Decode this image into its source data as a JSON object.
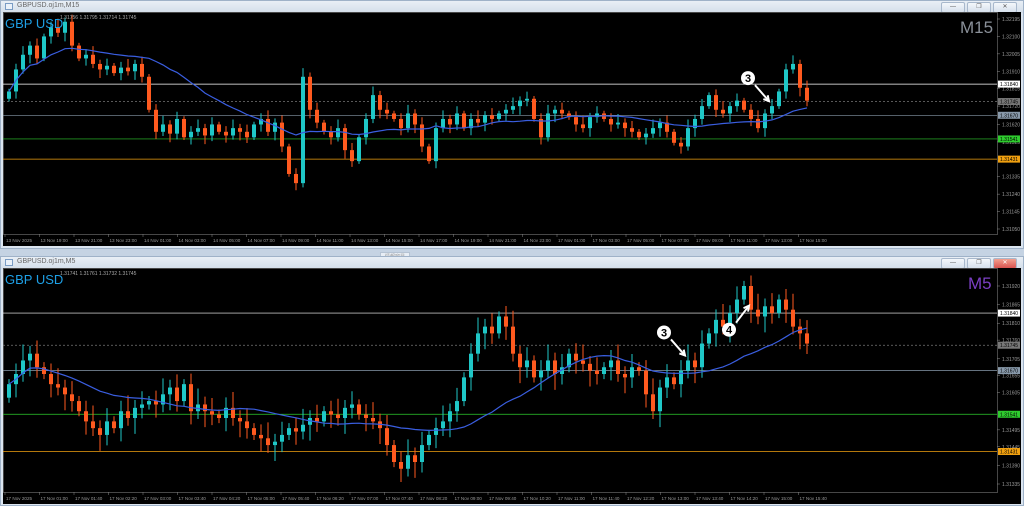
{
  "windows": [
    {
      "title": "GBPUSD.oj1m,M15",
      "ohlc": "1.31756 1.31795 1.31714 1.31745",
      "symbol_label": "GBP USD",
      "timeframe_label": "M15",
      "timeframe_color": "#8a9099",
      "buttons": [
        "minimize",
        "restore",
        "close"
      ]
    },
    {
      "title": "GBPUSD.oj1m,M5",
      "ohlc": "1.31741 1.31761 1.31732 1.31745",
      "symbol_label": "GBP USD",
      "timeframe_label": "M5",
      "timeframe_color": "#7b3fc4",
      "buttons": [
        "minimize",
        "restore",
        "close"
      ]
    }
  ],
  "mid_tab_label": "情報窗显",
  "colors": {
    "bull": "#1fc7c7",
    "bear": "#ff5a1f",
    "ma": "#3a5ee0",
    "grid_text": "#9a9a9a"
  },
  "chart_data": [
    {
      "type": "candlestick",
      "title": "GBPUSD M15",
      "ylim": [
        1.3105,
        1.32195
      ],
      "yticks": [
        "1.32195",
        "1.32100",
        "1.32005",
        "1.31910",
        "1.31815",
        "1.31720",
        "1.31620",
        "1.31525",
        "1.31335",
        "1.31240",
        "1.31145",
        "1.31050"
      ],
      "levels": [
        {
          "value": 1.3184,
          "label": "1.31840",
          "color": "#ffffff"
        },
        {
          "value": 1.31745,
          "label": "1.31745",
          "color": "#777777"
        },
        {
          "value": 1.3167,
          "label": "1.31670",
          "color": "#8899aa"
        },
        {
          "value": 1.31541,
          "label": "1.31541",
          "color": "#2ecc2e"
        },
        {
          "value": 1.31431,
          "label": "1.31431",
          "color": "#f0a010"
        }
      ],
      "xticks": [
        "13 Nov 2025",
        "13 Nov 19:00",
        "13 Nov 21:00",
        "13 Nov 23:00",
        "14 Nov 01:00",
        "14 Nov 03:00",
        "14 Nov 05:00",
        "14 Nov 07:00",
        "14 Nov 09:00",
        "14 Nov 11:00",
        "14 Nov 13:00",
        "14 Nov 15:00",
        "14 Nov 17:00",
        "14 Nov 19:00",
        "14 Nov 21:00",
        "14 Nov 23:00",
        "17 Nov 01:00",
        "17 Nov 03:00",
        "17 Nov 05:00",
        "17 Nov 07:00",
        "17 Nov 09:00",
        "17 Nov 11:00",
        "17 Nov 13:00",
        "17 Nov 15:00"
      ],
      "ma_period": 20,
      "closes": [
        1.318,
        1.3192,
        1.32,
        1.3205,
        1.3198,
        1.321,
        1.3215,
        1.3212,
        1.3218,
        1.3205,
        1.3198,
        1.32,
        1.3195,
        1.3192,
        1.3194,
        1.319,
        1.3193,
        1.3191,
        1.3195,
        1.3188,
        1.317,
        1.3158,
        1.3162,
        1.3157,
        1.3165,
        1.3155,
        1.3158,
        1.316,
        1.3156,
        1.3162,
        1.3158,
        1.3156,
        1.316,
        1.3158,
        1.3155,
        1.3162,
        1.3165,
        1.3158,
        1.3163,
        1.315,
        1.3135,
        1.313,
        1.3188,
        1.317,
        1.3163,
        1.3158,
        1.3155,
        1.316,
        1.3148,
        1.3142,
        1.3155,
        1.3165,
        1.3178,
        1.317,
        1.3168,
        1.3165,
        1.316,
        1.3168,
        1.3162,
        1.315,
        1.3142,
        1.316,
        1.3165,
        1.3162,
        1.3168,
        1.316,
        1.3165,
        1.3163,
        1.3167,
        1.3165,
        1.3168,
        1.317,
        1.3172,
        1.3175,
        1.3176,
        1.3165,
        1.3155,
        1.3168,
        1.317,
        1.3168,
        1.3166,
        1.3162,
        1.316,
        1.3166,
        1.3168,
        1.3165,
        1.3162,
        1.3163,
        1.316,
        1.3158,
        1.3155,
        1.3157,
        1.316,
        1.3163,
        1.3158,
        1.3152,
        1.315,
        1.316,
        1.3165,
        1.3172,
        1.3178,
        1.317,
        1.3168,
        1.3172,
        1.3175,
        1.317,
        1.3165,
        1.316,
        1.3168,
        1.3172,
        1.318,
        1.3192,
        1.3195,
        1.3182,
        1.3175
      ],
      "annotations": [
        {
          "label": "3",
          "bar": 109,
          "direction": "down-right"
        }
      ]
    },
    {
      "type": "candlestick",
      "title": "GBPUSD M5",
      "ylim": [
        1.31335,
        1.3192
      ],
      "yticks": [
        "1.31920",
        "1.31865",
        "1.31810",
        "1.31760",
        "1.31705",
        "1.31655",
        "1.31605",
        "1.31495",
        "1.31445",
        "1.31390",
        "1.31335"
      ],
      "levels": [
        {
          "value": 1.3184,
          "label": "1.31840",
          "color": "#ffffff"
        },
        {
          "value": 1.31745,
          "label": "1.31745",
          "color": "#777777"
        },
        {
          "value": 1.3167,
          "label": "1.31670",
          "color": "#8899aa"
        },
        {
          "value": 1.31541,
          "label": "1.31541",
          "color": "#2ecc2e"
        },
        {
          "value": 1.31431,
          "label": "1.31431",
          "color": "#f0a010"
        }
      ],
      "xticks": [
        "17 Nov 2025",
        "17 Nov 01:00",
        "17 Nov 01:40",
        "17 Nov 02:20",
        "17 Nov 03:00",
        "17 Nov 03:40",
        "17 Nov 04:20",
        "17 Nov 05:00",
        "17 Nov 05:40",
        "17 Nov 06:20",
        "17 Nov 07:00",
        "17 Nov 07:40",
        "17 Nov 08:20",
        "17 Nov 09:00",
        "17 Nov 09:40",
        "17 Nov 10:20",
        "17 Nov 11:00",
        "17 Nov 11:40",
        "17 Nov 12:20",
        "17 Nov 13:00",
        "17 Nov 13:40",
        "17 Nov 14:20",
        "17 Nov 15:00",
        "17 Nov 15:40"
      ],
      "ma_period": 20,
      "closes": [
        1.3163,
        1.3166,
        1.317,
        1.3172,
        1.3168,
        1.3166,
        1.3163,
        1.3162,
        1.316,
        1.3158,
        1.3155,
        1.3152,
        1.315,
        1.3148,
        1.3152,
        1.315,
        1.3155,
        1.3153,
        1.3156,
        1.3157,
        1.3158,
        1.3157,
        1.316,
        1.3162,
        1.3158,
        1.3163,
        1.3155,
        1.3157,
        1.3155,
        1.3154,
        1.3153,
        1.3156,
        1.3153,
        1.3152,
        1.315,
        1.3148,
        1.3147,
        1.3145,
        1.3146,
        1.3148,
        1.315,
        1.3149,
        1.3151,
        1.3153,
        1.3152,
        1.3155,
        1.3154,
        1.3153,
        1.3156,
        1.3157,
        1.3154,
        1.3153,
        1.3152,
        1.315,
        1.3145,
        1.314,
        1.3138,
        1.3142,
        1.314,
        1.3145,
        1.3148,
        1.315,
        1.3152,
        1.3155,
        1.3158,
        1.3165,
        1.3172,
        1.3178,
        1.318,
        1.3178,
        1.3183,
        1.318,
        1.3172,
        1.3168,
        1.317,
        1.3165,
        1.3167,
        1.317,
        1.3166,
        1.3168,
        1.3172,
        1.317,
        1.3169,
        1.3167,
        1.3166,
        1.3168,
        1.317,
        1.3166,
        1.3165,
        1.3168,
        1.3167,
        1.316,
        1.3155,
        1.3162,
        1.3165,
        1.3163,
        1.3167,
        1.317,
        1.3168,
        1.3175,
        1.3178,
        1.3182,
        1.318,
        1.3184,
        1.3188,
        1.3192,
        1.3185,
        1.3183,
        1.3186,
        1.3184,
        1.3188,
        1.3185,
        1.318,
        1.3178,
        1.3175
      ],
      "annotations": [
        {
          "label": "3",
          "bar": 97,
          "direction": "down-right"
        },
        {
          "label": "4",
          "bar": 106,
          "direction": "up-right"
        }
      ]
    }
  ]
}
